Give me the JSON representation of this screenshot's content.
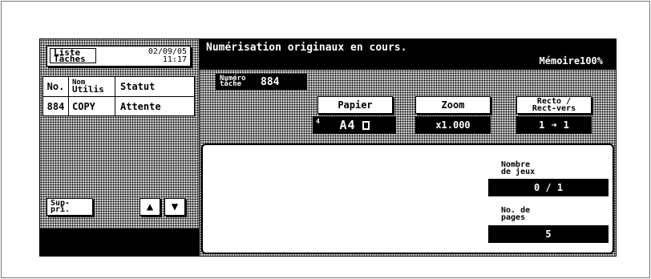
{
  "left_panel": {
    "job_list_button": {
      "line1": "Liste",
      "line2": "Tâches"
    },
    "date": "02/09/05",
    "time": "11:17",
    "columns": {
      "no": "No.",
      "user_line1": "Nom",
      "user_line2": "Utilis",
      "status": "Statut"
    },
    "rows": [
      {
        "no": "884",
        "user": "COPY",
        "status": "Attente"
      }
    ],
    "delete_button": {
      "line1": "Sup-",
      "line2": "pri."
    },
    "up_arrow": "▲",
    "down_arrow": "▼"
  },
  "header": {
    "message": "Numérisation originaux en cours.",
    "memory": "Mémoire100%"
  },
  "job_number": {
    "label_line1": "Numéro",
    "label_line2": "tâche",
    "value": "884"
  },
  "settings": {
    "paper": {
      "label": "Papier",
      "tray": "4",
      "value": "A4"
    },
    "zoom": {
      "label": "Zoom",
      "value": "x1.000"
    },
    "duplex": {
      "label_line1": "Recto /",
      "label_line2": "Rect-vers",
      "from": "1",
      "arrow": "➜",
      "to": "1"
    }
  },
  "counts": {
    "sets": {
      "label_line1": "Nombre",
      "label_line2": "de jeux",
      "value": "0 / 1"
    },
    "pages": {
      "label_line1": "No. de",
      "label_line2": "pages",
      "value": "5"
    }
  }
}
